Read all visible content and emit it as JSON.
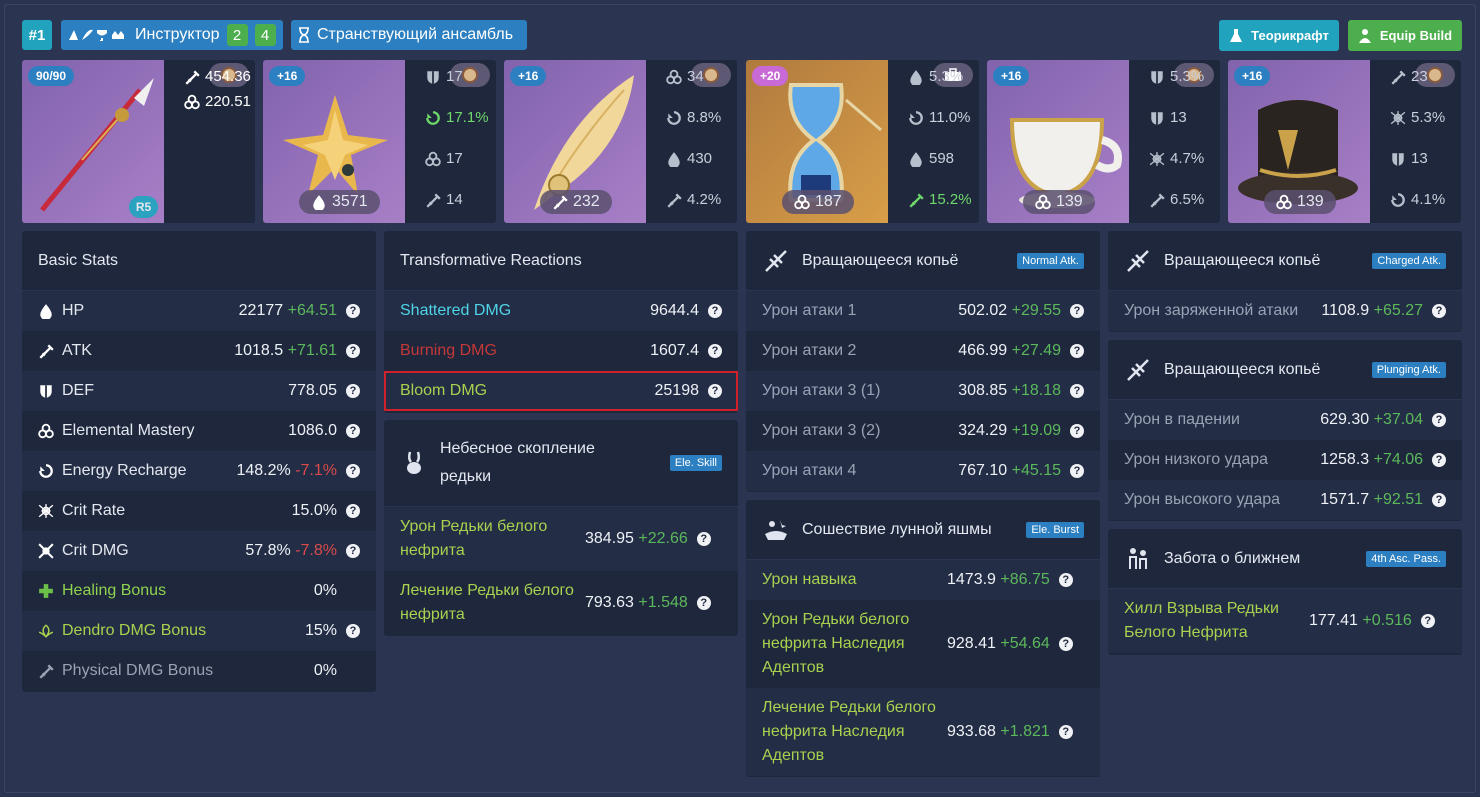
{
  "header": {
    "rank": "#1",
    "title": "Инструктор",
    "title_counts": [
      "2",
      "4"
    ],
    "set": "Странствующий ансамбль",
    "btn_teo": "Теорикрафт",
    "btn_equip": "Equip Build"
  },
  "cards": [
    {
      "level": "90/90",
      "refine": "R5",
      "subs": [
        {
          "icon": "atk",
          "text": "454.36"
        },
        {
          "icon": "em",
          "text": "220.51"
        }
      ]
    },
    {
      "level": "+16",
      "main": "3571",
      "main_icon": "hp",
      "subs": [
        {
          "icon": "def",
          "text": "17"
        },
        {
          "icon": "er",
          "text": "17.1%",
          "hl": true
        },
        {
          "icon": "em",
          "text": "17"
        },
        {
          "icon": "atk",
          "text": "14"
        }
      ]
    },
    {
      "level": "+16",
      "main": "232",
      "main_icon": "atk",
      "subs": [
        {
          "icon": "em",
          "text": "34"
        },
        {
          "icon": "er",
          "text": "8.8%"
        },
        {
          "icon": "hp",
          "text": "430"
        },
        {
          "icon": "atk",
          "text": "4.2%"
        }
      ]
    },
    {
      "level": "+20",
      "main": "187",
      "main_icon": "em",
      "subs": [
        {
          "icon": "hp",
          "text": "5.3%"
        },
        {
          "icon": "er",
          "text": "11.0%"
        },
        {
          "icon": "hp",
          "text": "598"
        },
        {
          "icon": "atk",
          "text": "15.2%",
          "hl": true
        }
      ]
    },
    {
      "level": "+16",
      "main": "139",
      "main_icon": "em",
      "subs": [
        {
          "icon": "def",
          "text": "5.3%"
        },
        {
          "icon": "def",
          "text": "13"
        },
        {
          "icon": "crit",
          "text": "4.7%"
        },
        {
          "icon": "atk",
          "text": "6.5%"
        }
      ]
    },
    {
      "level": "+16",
      "main": "139",
      "main_icon": "em",
      "subs": [
        {
          "icon": "atk",
          "text": "23"
        },
        {
          "icon": "crit",
          "text": "5.3%"
        },
        {
          "icon": "def",
          "text": "13"
        },
        {
          "icon": "er",
          "text": "4.1%"
        }
      ]
    }
  ],
  "basic": {
    "title": "Basic Stats",
    "rows": [
      {
        "icon": "hp",
        "label": "HP",
        "value": "22177",
        "delta": "+64.51",
        "sign": "plus"
      },
      {
        "icon": "atk",
        "label": "ATK",
        "value": "1018.5",
        "delta": "+71.61",
        "sign": "plus"
      },
      {
        "icon": "def",
        "label": "DEF",
        "value": "778.05",
        "delta": "",
        "sign": ""
      },
      {
        "icon": "em",
        "label": "Elemental Mastery",
        "value": "1086.0",
        "delta": "",
        "sign": ""
      },
      {
        "icon": "er",
        "label": "Energy Recharge",
        "value": "148.2%",
        "delta": "-7.1%",
        "sign": "minus"
      },
      {
        "icon": "crit",
        "label": "Crit Rate",
        "value": "15.0%",
        "delta": "",
        "sign": ""
      },
      {
        "icon": "critdmg",
        "label": "Crit DMG",
        "value": "57.8%",
        "delta": "-7.8%",
        "sign": "minus"
      },
      {
        "icon": "heal",
        "label": "Healing Bonus",
        "value": "0%",
        "delta": "",
        "sign": "",
        "cls": "heal",
        "noq": true
      },
      {
        "icon": "dendro",
        "label": "Dendro DMG Bonus",
        "value": "15%",
        "delta": "",
        "sign": "",
        "cls": "green"
      },
      {
        "icon": "phys",
        "label": "Physical DMG Bonus",
        "value": "0%",
        "delta": "",
        "sign": "",
        "cls": "gray",
        "noq": true
      }
    ]
  },
  "trans": {
    "title": "Transformative Reactions",
    "rows": [
      {
        "label": "Shattered DMG",
        "value": "9644.4",
        "cls": "cyan"
      },
      {
        "label": "Burning DMG",
        "value": "1607.4",
        "cls": "red"
      },
      {
        "label": "Bloom DMG",
        "value": "25198",
        "cls": "green"
      }
    ]
  },
  "skill": {
    "title": "Небесное скопление редьки",
    "badge": "Ele. Skill",
    "rows": [
      {
        "label": "Урон Редьки белого нефрита",
        "value": "384.95",
        "delta": "+22.66"
      },
      {
        "label": "Лечение Редьки белого нефрита",
        "value": "793.63",
        "delta": "+1.548"
      }
    ]
  },
  "normal": {
    "title": "Вращающееся копьё",
    "badge": "Normal Atk.",
    "rows": [
      {
        "label": "Урон атаки 1",
        "value": "502.02",
        "delta": "+29.55"
      },
      {
        "label": "Урон атаки 2",
        "value": "466.99",
        "delta": "+27.49"
      },
      {
        "label": "Урон атаки 3 (1)",
        "value": "308.85",
        "delta": "+18.18"
      },
      {
        "label": "Урон атаки 3 (2)",
        "value": "324.29",
        "delta": "+19.09"
      },
      {
        "label": "Урон атаки 4",
        "value": "767.10",
        "delta": "+45.15"
      }
    ]
  },
  "burst": {
    "title": "Сошествие лунной яшмы",
    "badge": "Ele. Burst",
    "rows": [
      {
        "label": "Урон навыка",
        "value": "1473.9",
        "delta": "+86.75"
      },
      {
        "label": "Урон Редьки белого нефрита Наследия Адептов",
        "value": "928.41",
        "delta": "+54.64"
      },
      {
        "label": "Лечение Редьки белого нефрита Наследия Адептов",
        "value": "933.68",
        "delta": "+1.821"
      }
    ]
  },
  "charged": {
    "title": "Вращающееся копьё",
    "badge": "Charged Atk.",
    "rows": [
      {
        "label": "Урон заряженной атаки",
        "value": "1108.9",
        "delta": "+65.27"
      }
    ]
  },
  "plunge": {
    "title": "Вращающееся копьё",
    "badge": "Plunging Atk.",
    "rows": [
      {
        "label": "Урон в падении",
        "value": "629.30",
        "delta": "+37.04"
      },
      {
        "label": "Урон низкого удара",
        "value": "1258.3",
        "delta": "+74.06"
      },
      {
        "label": "Урон высокого удара",
        "value": "1571.7",
        "delta": "+92.51"
      }
    ]
  },
  "passive": {
    "title": "Забота о ближнем",
    "badge": "4th Asc. Pass.",
    "rows": [
      {
        "label": "Хилл Взрыва Редьки Белого Нефрита",
        "value": "177.41",
        "delta": "+0.516"
      }
    ]
  }
}
